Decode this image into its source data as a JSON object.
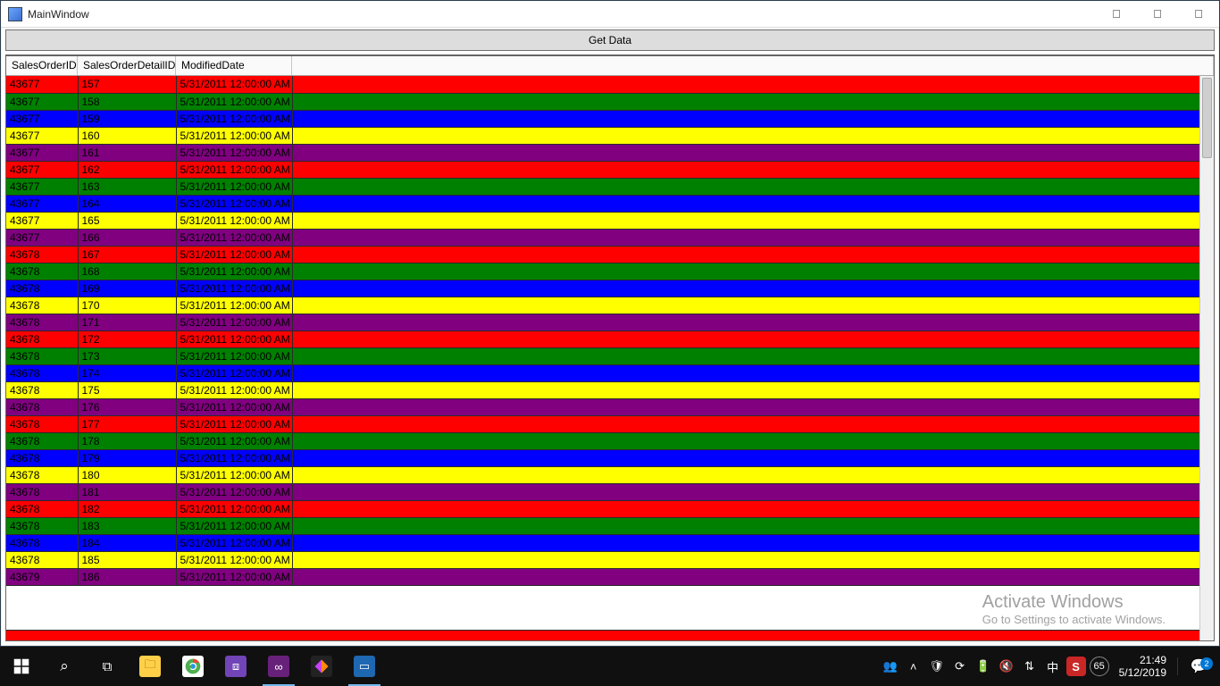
{
  "window": {
    "title": "MainWindow",
    "get_data_label": "Get Data"
  },
  "columns": [
    "SalesOrderID",
    "SalesOrderDetailID",
    "ModifiedDate"
  ],
  "rows": [
    {
      "c": "red",
      "v": [
        "43677",
        "157",
        "5/31/2011 12:00:00 AM"
      ]
    },
    {
      "c": "green",
      "v": [
        "43677",
        "158",
        "5/31/2011 12:00:00 AM"
      ]
    },
    {
      "c": "blue",
      "v": [
        "43677",
        "159",
        "5/31/2011 12:00:00 AM"
      ]
    },
    {
      "c": "yellow",
      "v": [
        "43677",
        "160",
        "5/31/2011 12:00:00 AM"
      ]
    },
    {
      "c": "purple",
      "v": [
        "43677",
        "161",
        "5/31/2011 12:00:00 AM"
      ]
    },
    {
      "c": "red",
      "v": [
        "43677",
        "162",
        "5/31/2011 12:00:00 AM"
      ]
    },
    {
      "c": "green",
      "v": [
        "43677",
        "163",
        "5/31/2011 12:00:00 AM"
      ]
    },
    {
      "c": "blue",
      "v": [
        "43677",
        "164",
        "5/31/2011 12:00:00 AM"
      ]
    },
    {
      "c": "yellow",
      "v": [
        "43677",
        "165",
        "5/31/2011 12:00:00 AM"
      ]
    },
    {
      "c": "purple",
      "v": [
        "43677",
        "166",
        "5/31/2011 12:00:00 AM"
      ]
    },
    {
      "c": "red",
      "v": [
        "43678",
        "167",
        "5/31/2011 12:00:00 AM"
      ]
    },
    {
      "c": "green",
      "v": [
        "43678",
        "168",
        "5/31/2011 12:00:00 AM"
      ]
    },
    {
      "c": "blue",
      "v": [
        "43678",
        "169",
        "5/31/2011 12:00:00 AM"
      ]
    },
    {
      "c": "yellow",
      "v": [
        "43678",
        "170",
        "5/31/2011 12:00:00 AM"
      ]
    },
    {
      "c": "purple",
      "v": [
        "43678",
        "171",
        "5/31/2011 12:00:00 AM"
      ]
    },
    {
      "c": "red",
      "v": [
        "43678",
        "172",
        "5/31/2011 12:00:00 AM"
      ]
    },
    {
      "c": "green",
      "v": [
        "43678",
        "173",
        "5/31/2011 12:00:00 AM"
      ]
    },
    {
      "c": "blue",
      "v": [
        "43678",
        "174",
        "5/31/2011 12:00:00 AM"
      ]
    },
    {
      "c": "yellow",
      "v": [
        "43678",
        "175",
        "5/31/2011 12:00:00 AM"
      ]
    },
    {
      "c": "purple",
      "v": [
        "43678",
        "176",
        "5/31/2011 12:00:00 AM"
      ]
    },
    {
      "c": "red",
      "v": [
        "43678",
        "177",
        "5/31/2011 12:00:00 AM"
      ]
    },
    {
      "c": "green",
      "v": [
        "43678",
        "178",
        "5/31/2011 12:00:00 AM"
      ]
    },
    {
      "c": "blue",
      "v": [
        "43678",
        "179",
        "5/31/2011 12:00:00 AM"
      ]
    },
    {
      "c": "yellow",
      "v": [
        "43678",
        "180",
        "5/31/2011 12:00:00 AM"
      ]
    },
    {
      "c": "purple",
      "v": [
        "43678",
        "181",
        "5/31/2011 12:00:00 AM"
      ]
    },
    {
      "c": "red",
      "v": [
        "43678",
        "182",
        "5/31/2011 12:00:00 AM"
      ]
    },
    {
      "c": "green",
      "v": [
        "43678",
        "183",
        "5/31/2011 12:00:00 AM"
      ]
    },
    {
      "c": "blue",
      "v": [
        "43678",
        "184",
        "5/31/2011 12:00:00 AM"
      ]
    },
    {
      "c": "yellow",
      "v": [
        "43678",
        "185",
        "5/31/2011 12:00:00 AM"
      ]
    },
    {
      "c": "purple",
      "v": [
        "43679",
        "186",
        "5/31/2011 12:00:00 AM"
      ]
    }
  ],
  "watermark": {
    "line1": "Activate Windows",
    "line2": "Go to Settings to activate Windows."
  },
  "taskbar": {
    "people_icon": "people",
    "tray_badge": "65",
    "s_label": "S",
    "time": "21:49",
    "date": "5/12/2019",
    "notif_count": "2"
  }
}
